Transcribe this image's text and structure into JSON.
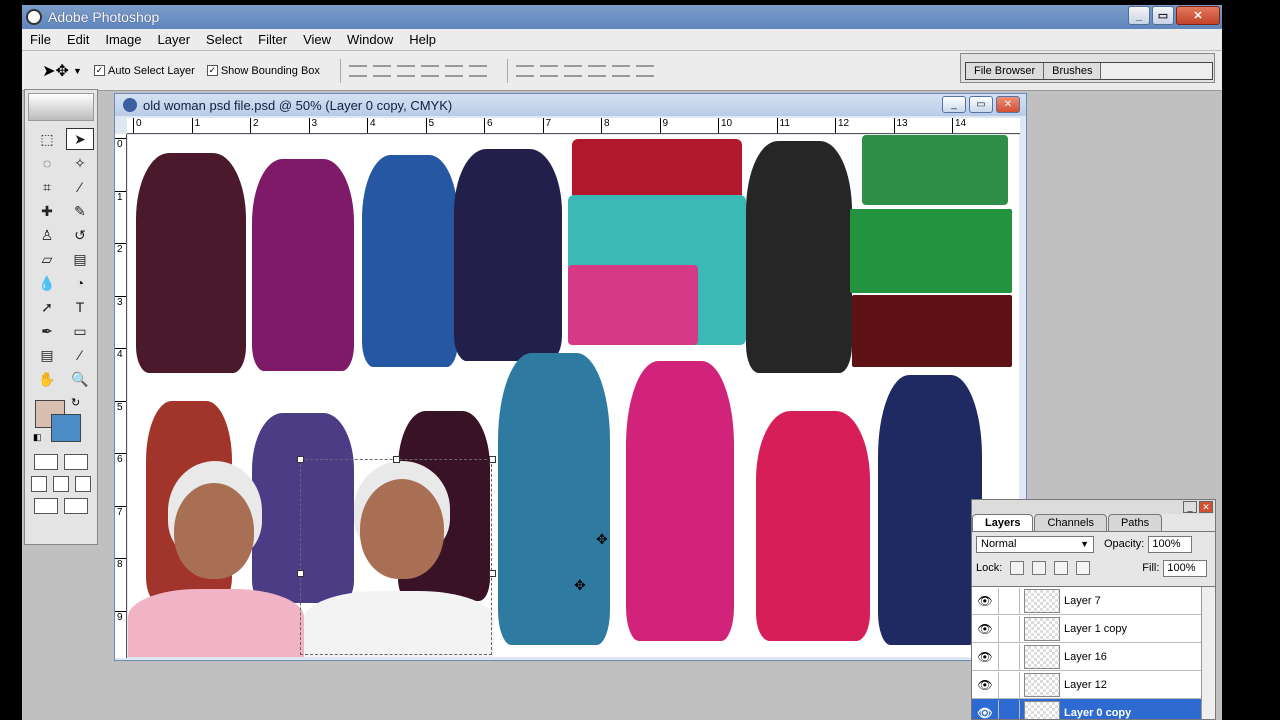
{
  "window": {
    "title": "Adobe Photoshop"
  },
  "menus": [
    "File",
    "Edit",
    "Image",
    "Layer",
    "Select",
    "Filter",
    "View",
    "Window",
    "Help"
  ],
  "options_bar": {
    "auto_select_label": "Auto Select Layer",
    "auto_select_checked": true,
    "bounding_box_label": "Show Bounding Box",
    "bounding_box_checked": true
  },
  "palette_well": {
    "tabs": [
      "File Browser",
      "Brushes"
    ]
  },
  "colors": {
    "foreground": "#d9bfb2",
    "background": "#4d8dc7"
  },
  "document": {
    "title": "old woman psd file.psd @ 50% (Layer 0 copy, CMYK)",
    "ruler_top": [
      "0",
      "1",
      "2",
      "3",
      "4",
      "5",
      "6",
      "7",
      "8",
      "9",
      "10",
      "11",
      "12",
      "13",
      "14"
    ],
    "ruler_left": [
      "0",
      "1",
      "2",
      "3",
      "4",
      "5",
      "6",
      "7",
      "8",
      "9"
    ]
  },
  "layers_panel": {
    "tabs": [
      "Layers",
      "Channels",
      "Paths"
    ],
    "blend_mode": "Normal",
    "opacity_label": "Opacity:",
    "opacity_value": "100%",
    "lock_label": "Lock:",
    "fill_label": "Fill:",
    "fill_value": "100%",
    "layers": [
      {
        "name": "Layer 7",
        "selected": false
      },
      {
        "name": "Layer 1 copy",
        "selected": false
      },
      {
        "name": "Layer 16",
        "selected": false
      },
      {
        "name": "Layer 12",
        "selected": false
      },
      {
        "name": "Layer 0 copy",
        "selected": true
      }
    ]
  }
}
